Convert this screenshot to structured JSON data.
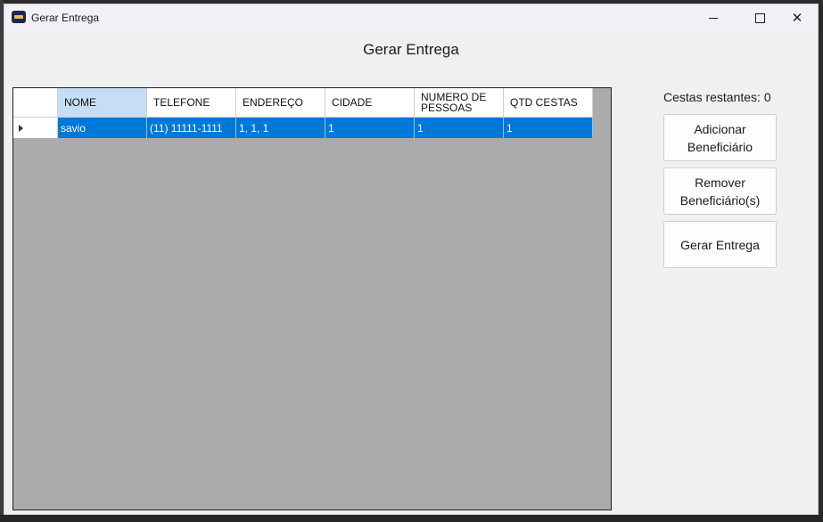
{
  "window": {
    "title": "Gerar Entrega"
  },
  "form": {
    "heading": "Gerar Entrega"
  },
  "grid": {
    "columns": [
      "NOME",
      "TELEFONE",
      "ENDEREÇO",
      "CIDADE",
      "NUMERO DE PESSOAS",
      "QTD CESTAS"
    ],
    "rows": [
      {
        "nome": "savio",
        "telefone": "(11) 11111-1111",
        "endereco": "1, 1, 1",
        "cidade": "1",
        "numero_pessoas": "1",
        "qtd_cestas": "1"
      }
    ]
  },
  "side": {
    "cestas_label": "Cestas restantes:",
    "cestas_value": "0",
    "add_button": "Adicionar Beneficiário",
    "remove_button": "Remover Beneficiário(s)",
    "generate_button": "Gerar Entrega"
  }
}
